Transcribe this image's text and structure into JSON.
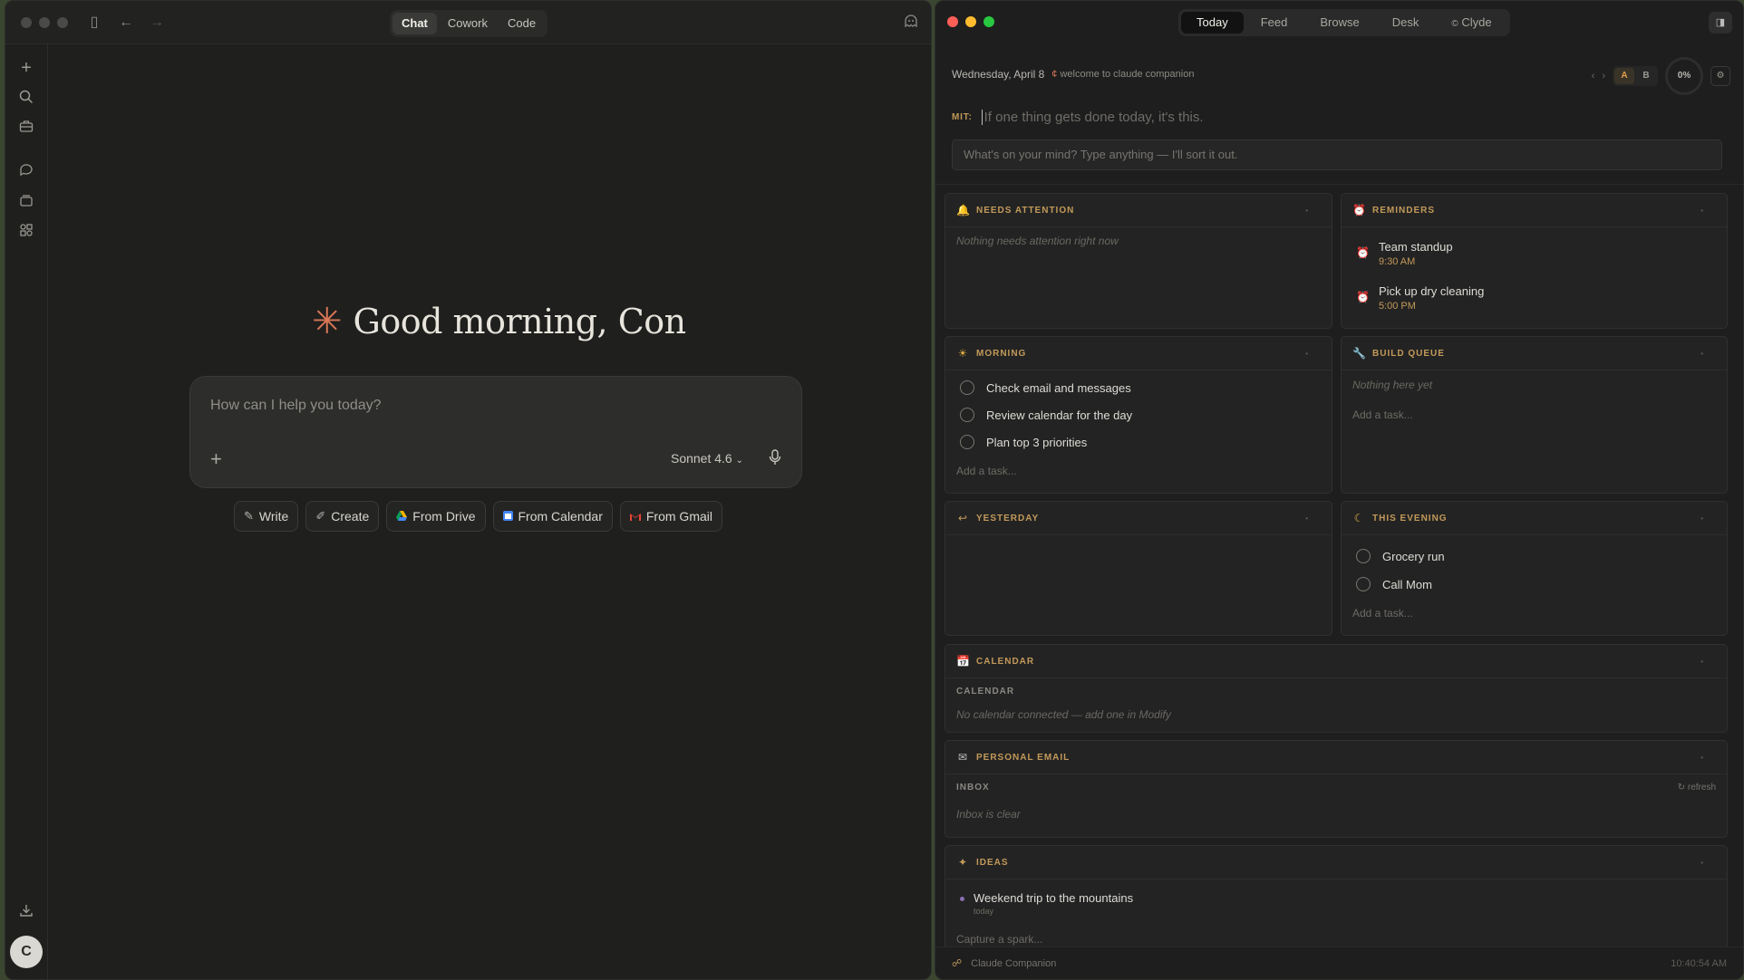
{
  "left": {
    "mode_tabs": [
      "Chat",
      "Cowork",
      "Code"
    ],
    "active_mode": "Chat",
    "greeting": "Good morning, Con",
    "composer_placeholder": "How can I help you today?",
    "model": "Sonnet 4.6",
    "chips": [
      {
        "label": "Write",
        "icon": "pencil-icon"
      },
      {
        "label": "Create",
        "icon": "brush-icon"
      },
      {
        "label": "From Drive",
        "icon": "drive-icon"
      },
      {
        "label": "From Calendar",
        "icon": "calendar-icon"
      },
      {
        "label": "From Gmail",
        "icon": "gmail-icon"
      }
    ],
    "avatar_initial": "C",
    "accent": "#d97757"
  },
  "right": {
    "nav_tabs": [
      "Today",
      "Feed",
      "Browse",
      "Desk",
      "Clyde"
    ],
    "active_tab": "Today",
    "date": "Wednesday, April 8",
    "welcome": "welcome to claude companion",
    "ab_options": [
      "A",
      "B"
    ],
    "ab_selected": "A",
    "progress": "0%",
    "mit_label": "MIT:",
    "mit_placeholder": "If one thing gets done today, it's this.",
    "brain_placeholder": "What's on your mind? Type anything — I'll sort it out.",
    "needs_attention": {
      "title": "NEEDS ATTENTION",
      "empty": "Nothing needs attention right now"
    },
    "reminders": {
      "title": "REMINDERS",
      "items": [
        {
          "text": "Team standup",
          "time": "9:30 AM"
        },
        {
          "text": "Pick up dry cleaning",
          "time": "5:00 PM"
        }
      ]
    },
    "morning": {
      "title": "MORNING",
      "tasks": [
        "Check email and messages",
        "Review calendar for the day",
        "Plan top 3 priorities"
      ],
      "add": "Add a task..."
    },
    "build_queue": {
      "title": "BUILD QUEUE",
      "empty": "Nothing here yet",
      "add": "Add a task..."
    },
    "yesterday": {
      "title": "YESTERDAY"
    },
    "evening": {
      "title": "THIS EVENING",
      "tasks": [
        "Grocery run",
        "Call Mom"
      ],
      "add": "Add a task..."
    },
    "calendar": {
      "title": "CALENDAR",
      "sub": "CALENDAR",
      "empty": "No calendar connected — add one in Modify"
    },
    "email": {
      "title": "PERSONAL EMAIL",
      "sub": "INBOX",
      "refresh": "↻ refresh",
      "empty": "Inbox is clear"
    },
    "ideas": {
      "title": "IDEAS",
      "items": [
        {
          "text": "Weekend trip to the mountains",
          "when": "today"
        }
      ],
      "capture": "Capture a spark..."
    },
    "footer": {
      "app": "Claude Companion",
      "time": "10:40:54 AM"
    },
    "accent": "#c39a5a"
  }
}
